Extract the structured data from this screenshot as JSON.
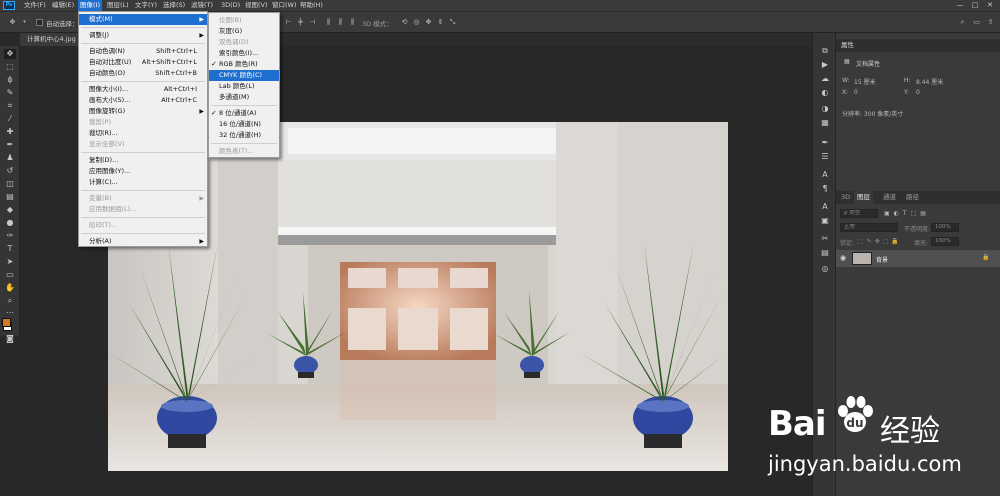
{
  "menubar": {
    "logo": "Ps",
    "items": [
      "文件(F)",
      "编辑(E)",
      "图像(I)",
      "图层(L)",
      "文字(Y)",
      "选择(S)",
      "滤镜(T)",
      "3D(D)",
      "视图(V)",
      "窗口(W)",
      "帮助(H)"
    ],
    "active_index": 2,
    "window_controls": [
      "—",
      "□",
      "✕"
    ]
  },
  "optionsbar": {
    "auto_select_label": "自动选择：",
    "mode_label": "3D 模式："
  },
  "document": {
    "tab_label": "计算机中心4.jpg",
    "tab_close": "×"
  },
  "image_menu": {
    "items": [
      {
        "label": "模式(M)",
        "shortcut": "",
        "submenu": true,
        "state": "highlight"
      },
      {
        "sep": true
      },
      {
        "label": "调整(J)",
        "shortcut": "",
        "submenu": true
      },
      {
        "sep": true
      },
      {
        "label": "自动色调(N)",
        "shortcut": "Shift+Ctrl+L"
      },
      {
        "label": "自动对比度(U)",
        "shortcut": "Alt+Shift+Ctrl+L"
      },
      {
        "label": "自动颜色(O)",
        "shortcut": "Shift+Ctrl+B"
      },
      {
        "sep": true
      },
      {
        "label": "图像大小(I)...",
        "shortcut": "Alt+Ctrl+I"
      },
      {
        "label": "画布大小(S)...",
        "shortcut": "Alt+Ctrl+C"
      },
      {
        "label": "图像旋转(G)",
        "shortcut": "",
        "submenu": true
      },
      {
        "label": "裁剪(P)",
        "shortcut": "",
        "state": "disabled"
      },
      {
        "label": "裁切(R)...",
        "shortcut": ""
      },
      {
        "label": "显示全部(V)",
        "shortcut": "",
        "state": "disabled"
      },
      {
        "sep": true
      },
      {
        "label": "复制(D)...",
        "shortcut": ""
      },
      {
        "label": "应用图像(Y)...",
        "shortcut": ""
      },
      {
        "label": "计算(C)...",
        "shortcut": ""
      },
      {
        "sep": true
      },
      {
        "label": "变量(B)",
        "shortcut": "",
        "submenu": true,
        "state": "disabled"
      },
      {
        "label": "应用数据组(L)...",
        "shortcut": "",
        "state": "disabled"
      },
      {
        "sep": true
      },
      {
        "label": "陷印(T)...",
        "shortcut": "",
        "state": "disabled"
      },
      {
        "sep": true
      },
      {
        "label": "分析(A)",
        "shortcut": "",
        "submenu": true
      }
    ]
  },
  "mode_submenu": {
    "items": [
      {
        "label": "位图(B)",
        "state": "disabled"
      },
      {
        "label": "灰度(G)"
      },
      {
        "label": "双色调(D)",
        "state": "disabled"
      },
      {
        "label": "索引颜色(I)..."
      },
      {
        "label": "RGB 颜色(R)",
        "checked": true
      },
      {
        "label": "CMYK 颜色(C)",
        "state": "highlight"
      },
      {
        "label": "Lab 颜色(L)"
      },
      {
        "label": "多通道(M)"
      },
      {
        "sep": true
      },
      {
        "label": "8 位/通道(A)",
        "checked": true
      },
      {
        "label": "16 位/通道(N)"
      },
      {
        "label": "32 位/通道(H)"
      },
      {
        "sep": true
      },
      {
        "label": "颜色表(T)...",
        "state": "disabled"
      }
    ]
  },
  "properties_panel": {
    "title": "属性",
    "doc_props_label": "文档属性",
    "w_label": "W:",
    "w_value": "15 厘米",
    "h_label": "H:",
    "h_value": "8.44 厘米",
    "x_label": "X:",
    "x_value": "0",
    "y_label": "Y:",
    "y_value": "0",
    "resolution": "分辨率: 300 像素/英寸"
  },
  "layers_panel": {
    "tabs": [
      "3D",
      "图层",
      "通道",
      "路径"
    ],
    "active_tab_index": 1,
    "kind_filter": "ρ 类型",
    "blend_mode": "正常",
    "opacity_label": "不透明度:",
    "opacity_value": "100%",
    "lock_label": "锁定:",
    "fill_label": "填充:",
    "fill_value": "100%",
    "layer_name": "背景"
  },
  "watermark": {
    "logo_text_1": "Bai",
    "logo_text_2": "经验",
    "url": "jingyan.baidu.com"
  },
  "colors": {
    "menu_highlight": "#1f6fd1",
    "foreground_swatch": "#d47a1c",
    "background_swatch": "#ffffff"
  }
}
